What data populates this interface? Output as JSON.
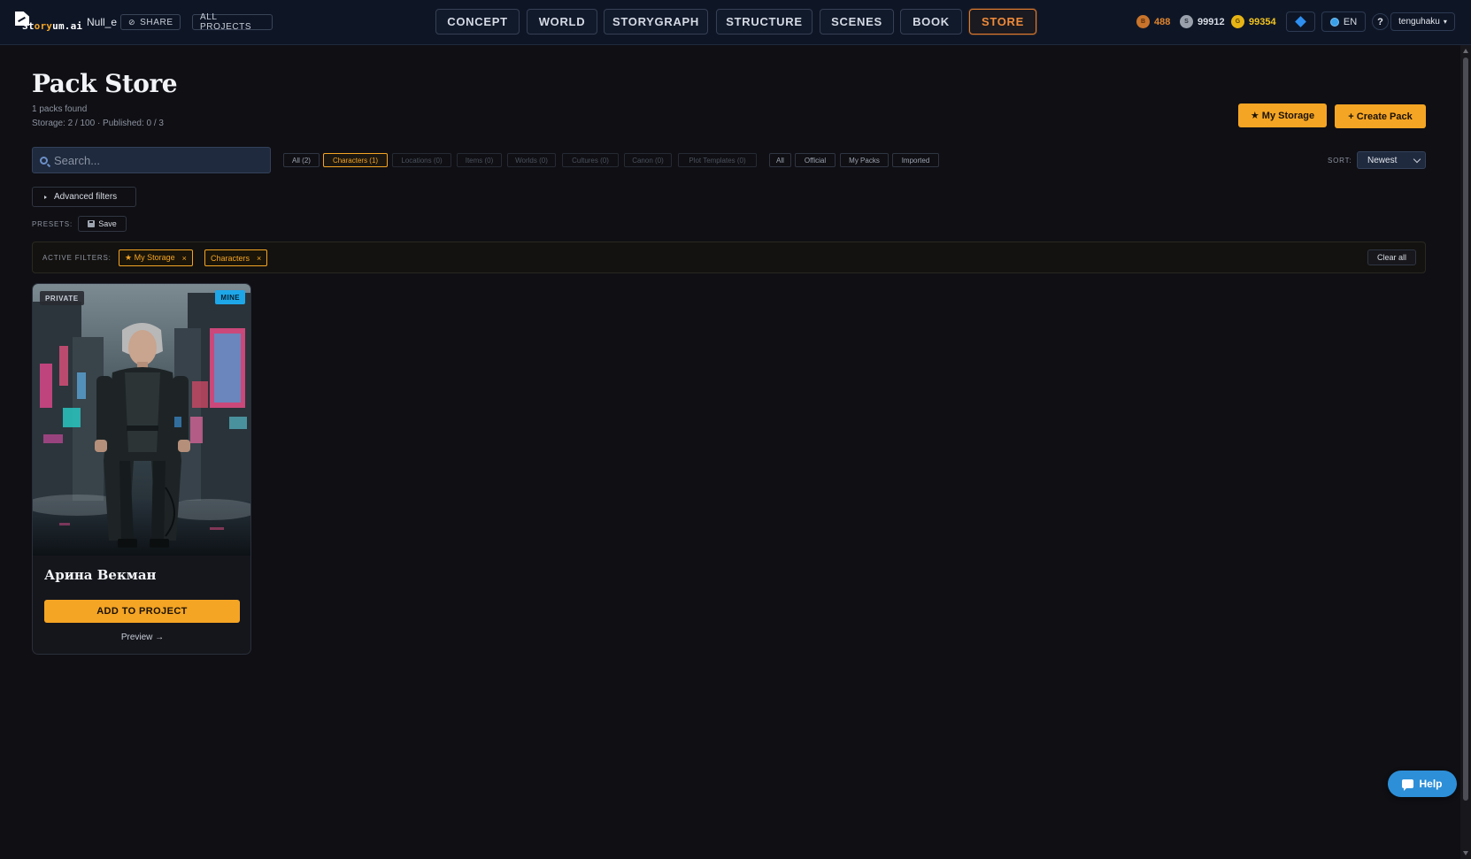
{
  "topbar": {
    "logo_text_1": "St",
    "logo_text_2": "ory",
    "logo_text_3": "um.ai",
    "project_name": "Null_e",
    "share_label": "SHARE",
    "all_projects_label": "ALL PROJECTS",
    "nav_tabs": [
      {
        "label": "CONCEPT",
        "active": false
      },
      {
        "label": "WORLD",
        "active": false
      },
      {
        "label": "STORYGRAPH",
        "active": false
      },
      {
        "label": "STRUCTURE",
        "active": false
      },
      {
        "label": "SCENES",
        "active": false
      },
      {
        "label": "BOOK",
        "active": false
      },
      {
        "label": "STORE",
        "active": true
      }
    ],
    "currencies": [
      {
        "symbol": "B",
        "value": "488",
        "color": "#e0852e"
      },
      {
        "symbol": "S",
        "value": "99912",
        "color": "#d7dbe3"
      },
      {
        "symbol": "G",
        "value": "99354",
        "color": "#f2c31f"
      }
    ],
    "language": "EN",
    "help_symbol": "?",
    "username": "tenguhaku",
    "user_caret": "▾"
  },
  "page": {
    "title": "Pack Store",
    "packs_found": "1 packs found",
    "storage_info": "Storage: 2 / 100 · Published: 0 / 3",
    "my_storage_label": "★ My Storage",
    "create_pack_label": "+ Create Pack"
  },
  "search": {
    "placeholder": "Search...",
    "value": ""
  },
  "type_chips": [
    {
      "label": "All (2)",
      "state": "normal"
    },
    {
      "label": "Characters (1)",
      "state": "active"
    },
    {
      "label": "Locations (0)",
      "state": "muted"
    },
    {
      "label": "Items (0)",
      "state": "muted"
    },
    {
      "label": "Worlds (0)",
      "state": "muted"
    },
    {
      "label": "Cultures (0)",
      "state": "muted"
    },
    {
      "label": "Canon (0)",
      "state": "muted"
    },
    {
      "label": "Plot Templates (0)",
      "state": "muted"
    }
  ],
  "source_chips": [
    {
      "label": "All"
    },
    {
      "label": "Official"
    },
    {
      "label": "My Packs"
    },
    {
      "label": "Imported"
    }
  ],
  "sort": {
    "label": "SORT:",
    "value": "Newest"
  },
  "advanced_filters_label": "Advanced filters",
  "presets": {
    "label": "PRESETS:",
    "save_label": "Save"
  },
  "active_filters": {
    "label": "ACTIVE FILTERS:",
    "tags": [
      {
        "label": "★ My Storage",
        "remove": "×"
      },
      {
        "label": "Characters",
        "remove": "×"
      }
    ],
    "clear_label": "Clear all"
  },
  "packs": [
    {
      "name": "Арина Векман",
      "badge_left": "PRIVATE",
      "badge_right": "MINE",
      "add_label": "ADD TO PROJECT",
      "preview_label": "Preview →"
    }
  ],
  "help_label": "Help"
}
